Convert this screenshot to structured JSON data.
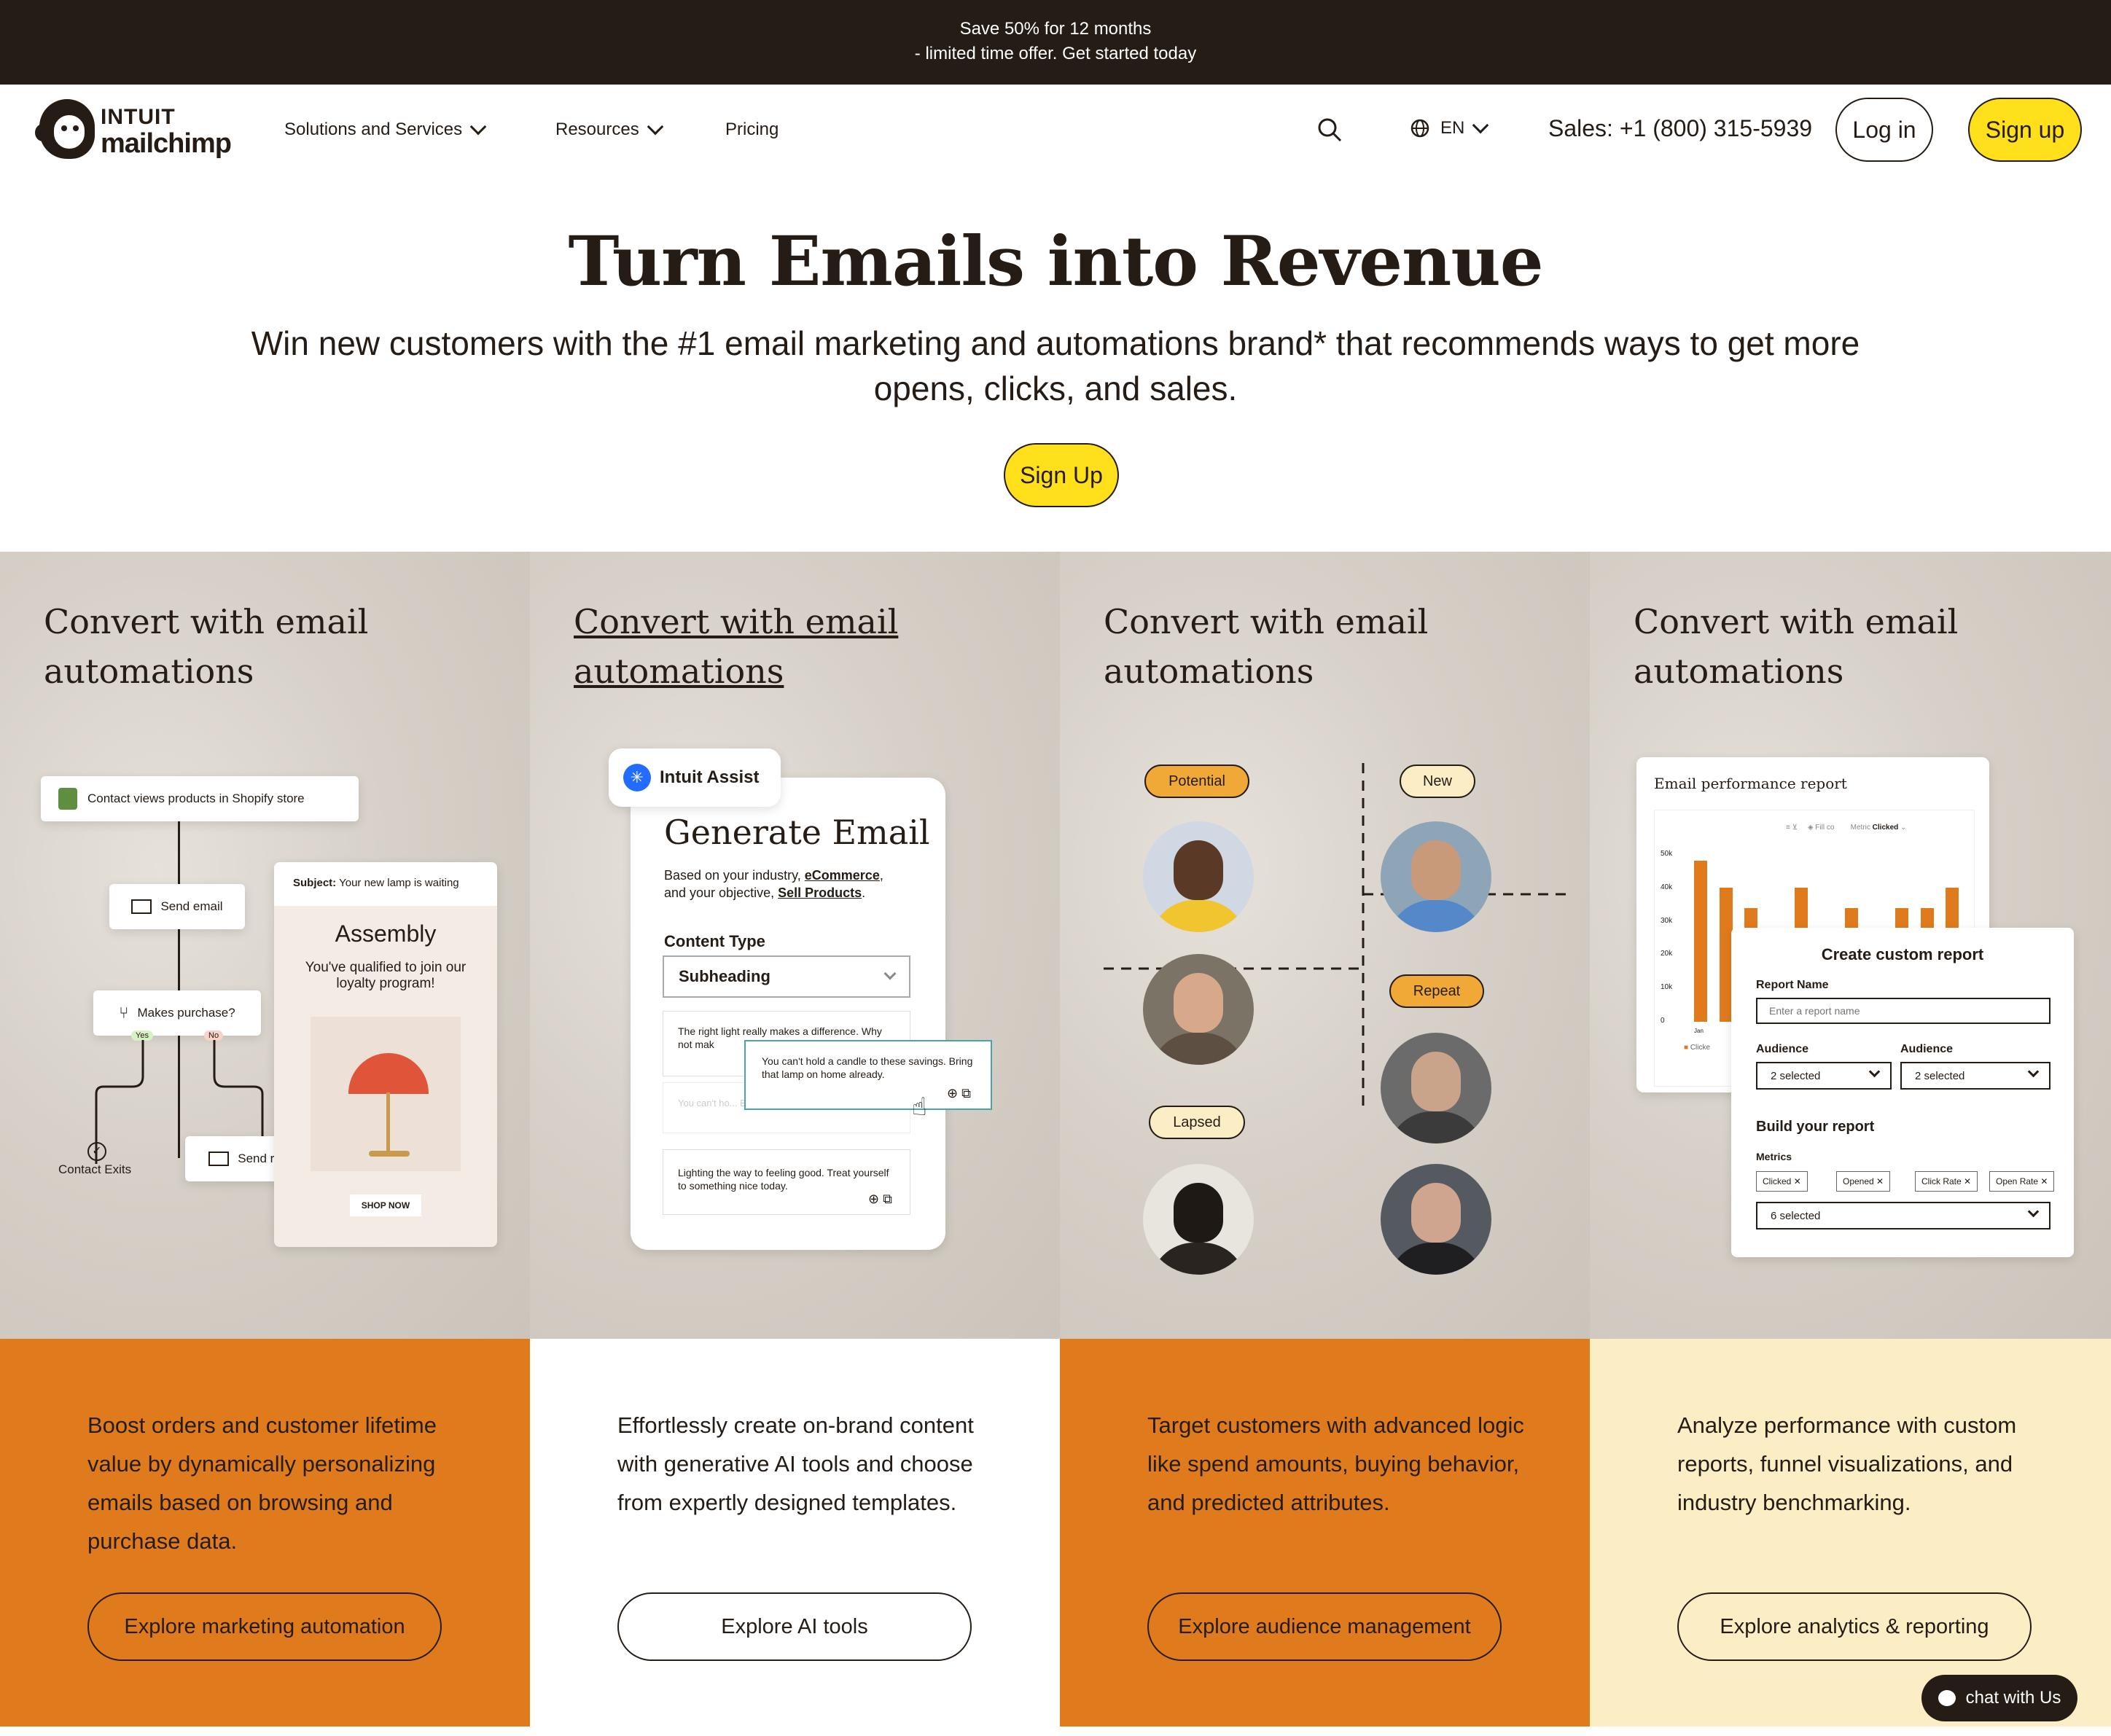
{
  "promo": {
    "line1": "Save 50% for 12 months",
    "line2": "- limited time offer. Get started today"
  },
  "nav": {
    "logo_top": "INTUIT",
    "logo_bottom": "mailchimp",
    "items": [
      {
        "label": "Solutions and Services"
      },
      {
        "label": "Resources"
      },
      {
        "label": "Pricing"
      }
    ],
    "lang": "EN",
    "sales": "Sales: +1 (800) 315-5939",
    "login": "Log in",
    "signup": "Sign up"
  },
  "hero": {
    "title": "Turn Emails into Revenue",
    "subtitle": "Win new customers with the #1 email marketing and automations brand* that recommends ways to get more opens, clicks, and sales.",
    "cta": "Sign Up"
  },
  "columns": [
    {
      "title": "Convert with email automations",
      "desc": "Boost orders and customer lifetime value by dynamically personalizing emails based on browsing and purchase data.",
      "button": "Explore marketing automation"
    },
    {
      "title": "Convert with email automations",
      "desc": "Effortlessly create on-brand content with generative AI tools and choose from expertly designed templates.",
      "button": "Explore AI tools"
    },
    {
      "title": "Convert with email automations",
      "desc": "Target customers with advanced logic like spend amounts, buying behavior, and predicted attributes.",
      "button": "Explore audience management"
    },
    {
      "title": "Convert with email automations",
      "desc": "Analyze performance with custom reports, funnel visualizations, and industry benchmarking.",
      "button": "Explore analytics & reporting"
    }
  ],
  "flow": {
    "trigger": "Contact views products in Shopify store",
    "send_email": "Send email",
    "condition": "Makes purchase?",
    "yes": "Yes",
    "no": "No",
    "exit": "Contact Exits",
    "reminder": "Send reminder",
    "email_subject_label": "Subject:",
    "email_subject": "Your new lamp is waiting",
    "email_brand": "Assembly",
    "email_body": "You've qualified to join our loyalty program!",
    "email_cta": "SHOP NOW"
  },
  "assist": {
    "badge": "Intuit Assist",
    "title": "Generate Email",
    "based_prefix": "Based on your industry, ",
    "industry": "eCommerce",
    "based_mid": ",",
    "objective_prefix": "and your objective, ",
    "objective": "Sell Products",
    "content_type_label": "Content Type",
    "content_type_value": "Subheading",
    "option1": "The right light really makes a difference. Why not mak",
    "popup": "You can't hold a candle to these savings. Bring that lamp on home already.",
    "option2_faded": "You can't ho... Bring that lamp on home already.",
    "option3": "Lighting the way to feeling good. Treat yourself to something nice today."
  },
  "audience": {
    "potential": "Potential",
    "new": "New",
    "repeat": "Repeat",
    "lapsed": "Lapsed"
  },
  "report": {
    "title": "Email performance report",
    "fill_label": "Fill co",
    "metric_label": "Metric",
    "metric_value": "Clicked",
    "yticks": [
      "50k",
      "40k",
      "30k",
      "20k",
      "10k",
      "0"
    ],
    "xtick": "Jan",
    "legend": "Clicke",
    "bars": [
      48,
      40,
      34,
      14,
      40,
      12,
      34,
      12,
      34,
      34,
      40
    ]
  },
  "custom_report": {
    "title": "Create custom report",
    "name_label": "Report Name",
    "name_placeholder": "Enter a report name",
    "audience1_label": "Audience",
    "audience1_value": "2 selected",
    "audience2_label": "Audience",
    "audience2_value": "2 selected",
    "build": "Build your report",
    "metrics_label": "Metrics",
    "tags": [
      "Clicked",
      "Opened",
      "Click Rate",
      "Open Rate"
    ],
    "metrics_value": "6 selected"
  },
  "chat": {
    "label": "chat with Us"
  },
  "colors": {
    "yellow": "#ffe01b",
    "orange": "#e07b1d",
    "cream": "#fbeec4",
    "dark": "#241c15"
  }
}
